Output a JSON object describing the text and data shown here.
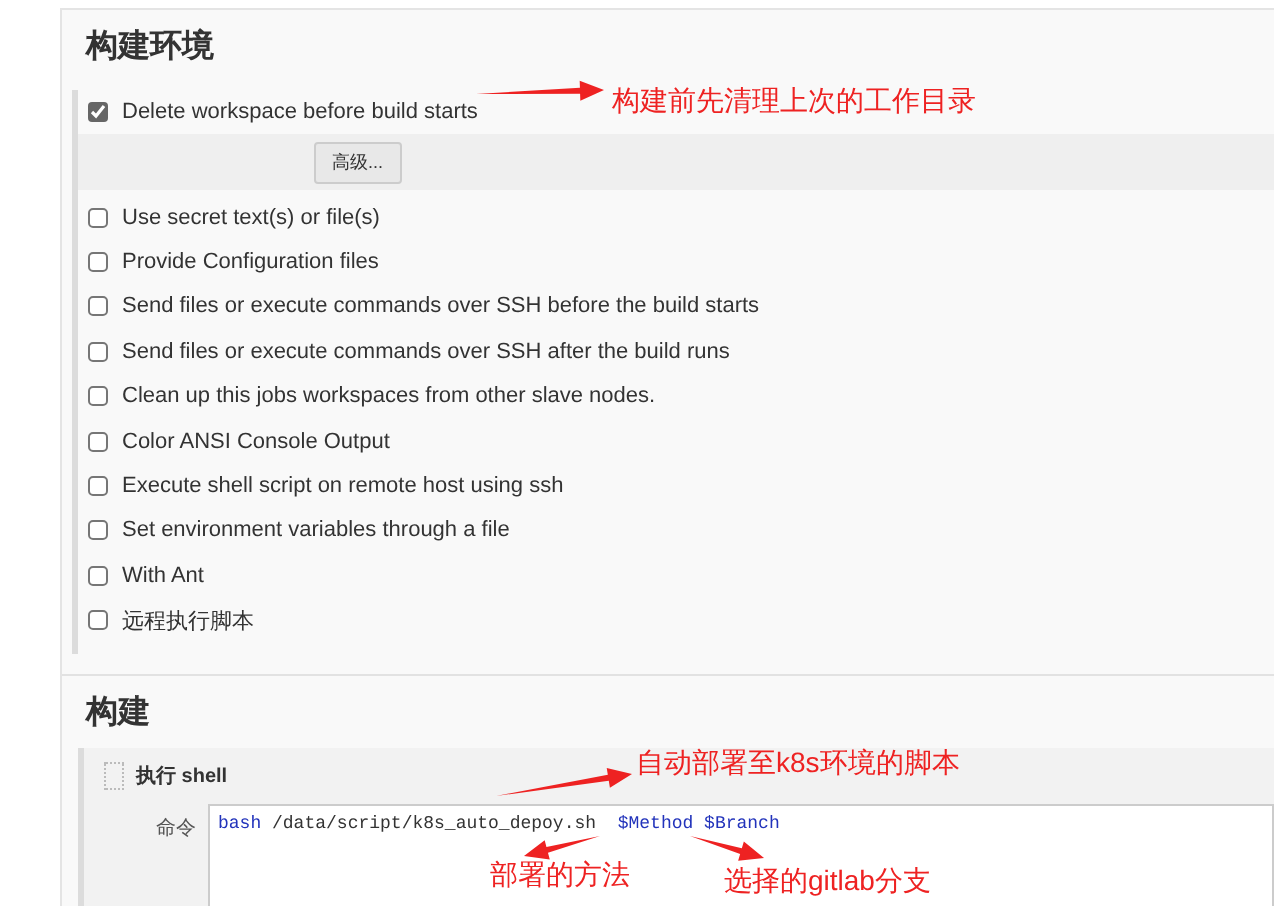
{
  "build_environment": {
    "title": "构建环境",
    "options": [
      {
        "label": "Delete workspace before build starts",
        "checked": true
      },
      {
        "label": "Use secret text(s) or file(s)",
        "checked": false
      },
      {
        "label": "Provide Configuration files",
        "checked": false
      },
      {
        "label": "Send files or execute commands over SSH before the build starts",
        "checked": false
      },
      {
        "label": "Send files or execute commands over SSH after the build runs",
        "checked": false
      },
      {
        "label": "Clean up this jobs workspaces from other slave nodes.",
        "checked": false
      },
      {
        "label": "Color ANSI Console Output",
        "checked": false
      },
      {
        "label": "Execute shell script on remote host using ssh",
        "checked": false
      },
      {
        "label": "Set environment variables through a file",
        "checked": false
      },
      {
        "label": "With Ant",
        "checked": false
      },
      {
        "label": "远程执行脚本",
        "checked": false
      }
    ],
    "advanced_button": "高级..."
  },
  "build": {
    "title": "构建",
    "step_title": "执行 shell",
    "command_label": "命令",
    "command": [
      {
        "text": "bash",
        "kind": "keyword"
      },
      {
        "text": " /data/script/k8s_auto_depoy.sh  ",
        "kind": "plain"
      },
      {
        "text": "$Method $Branch",
        "kind": "variable"
      }
    ]
  },
  "annotations": [
    {
      "text": "构建前先清理上次的工作目录"
    },
    {
      "text": "自动部署至k8s环境的脚本"
    },
    {
      "text": "部署的方法"
    },
    {
      "text": "选择的gitlab分支"
    }
  ]
}
